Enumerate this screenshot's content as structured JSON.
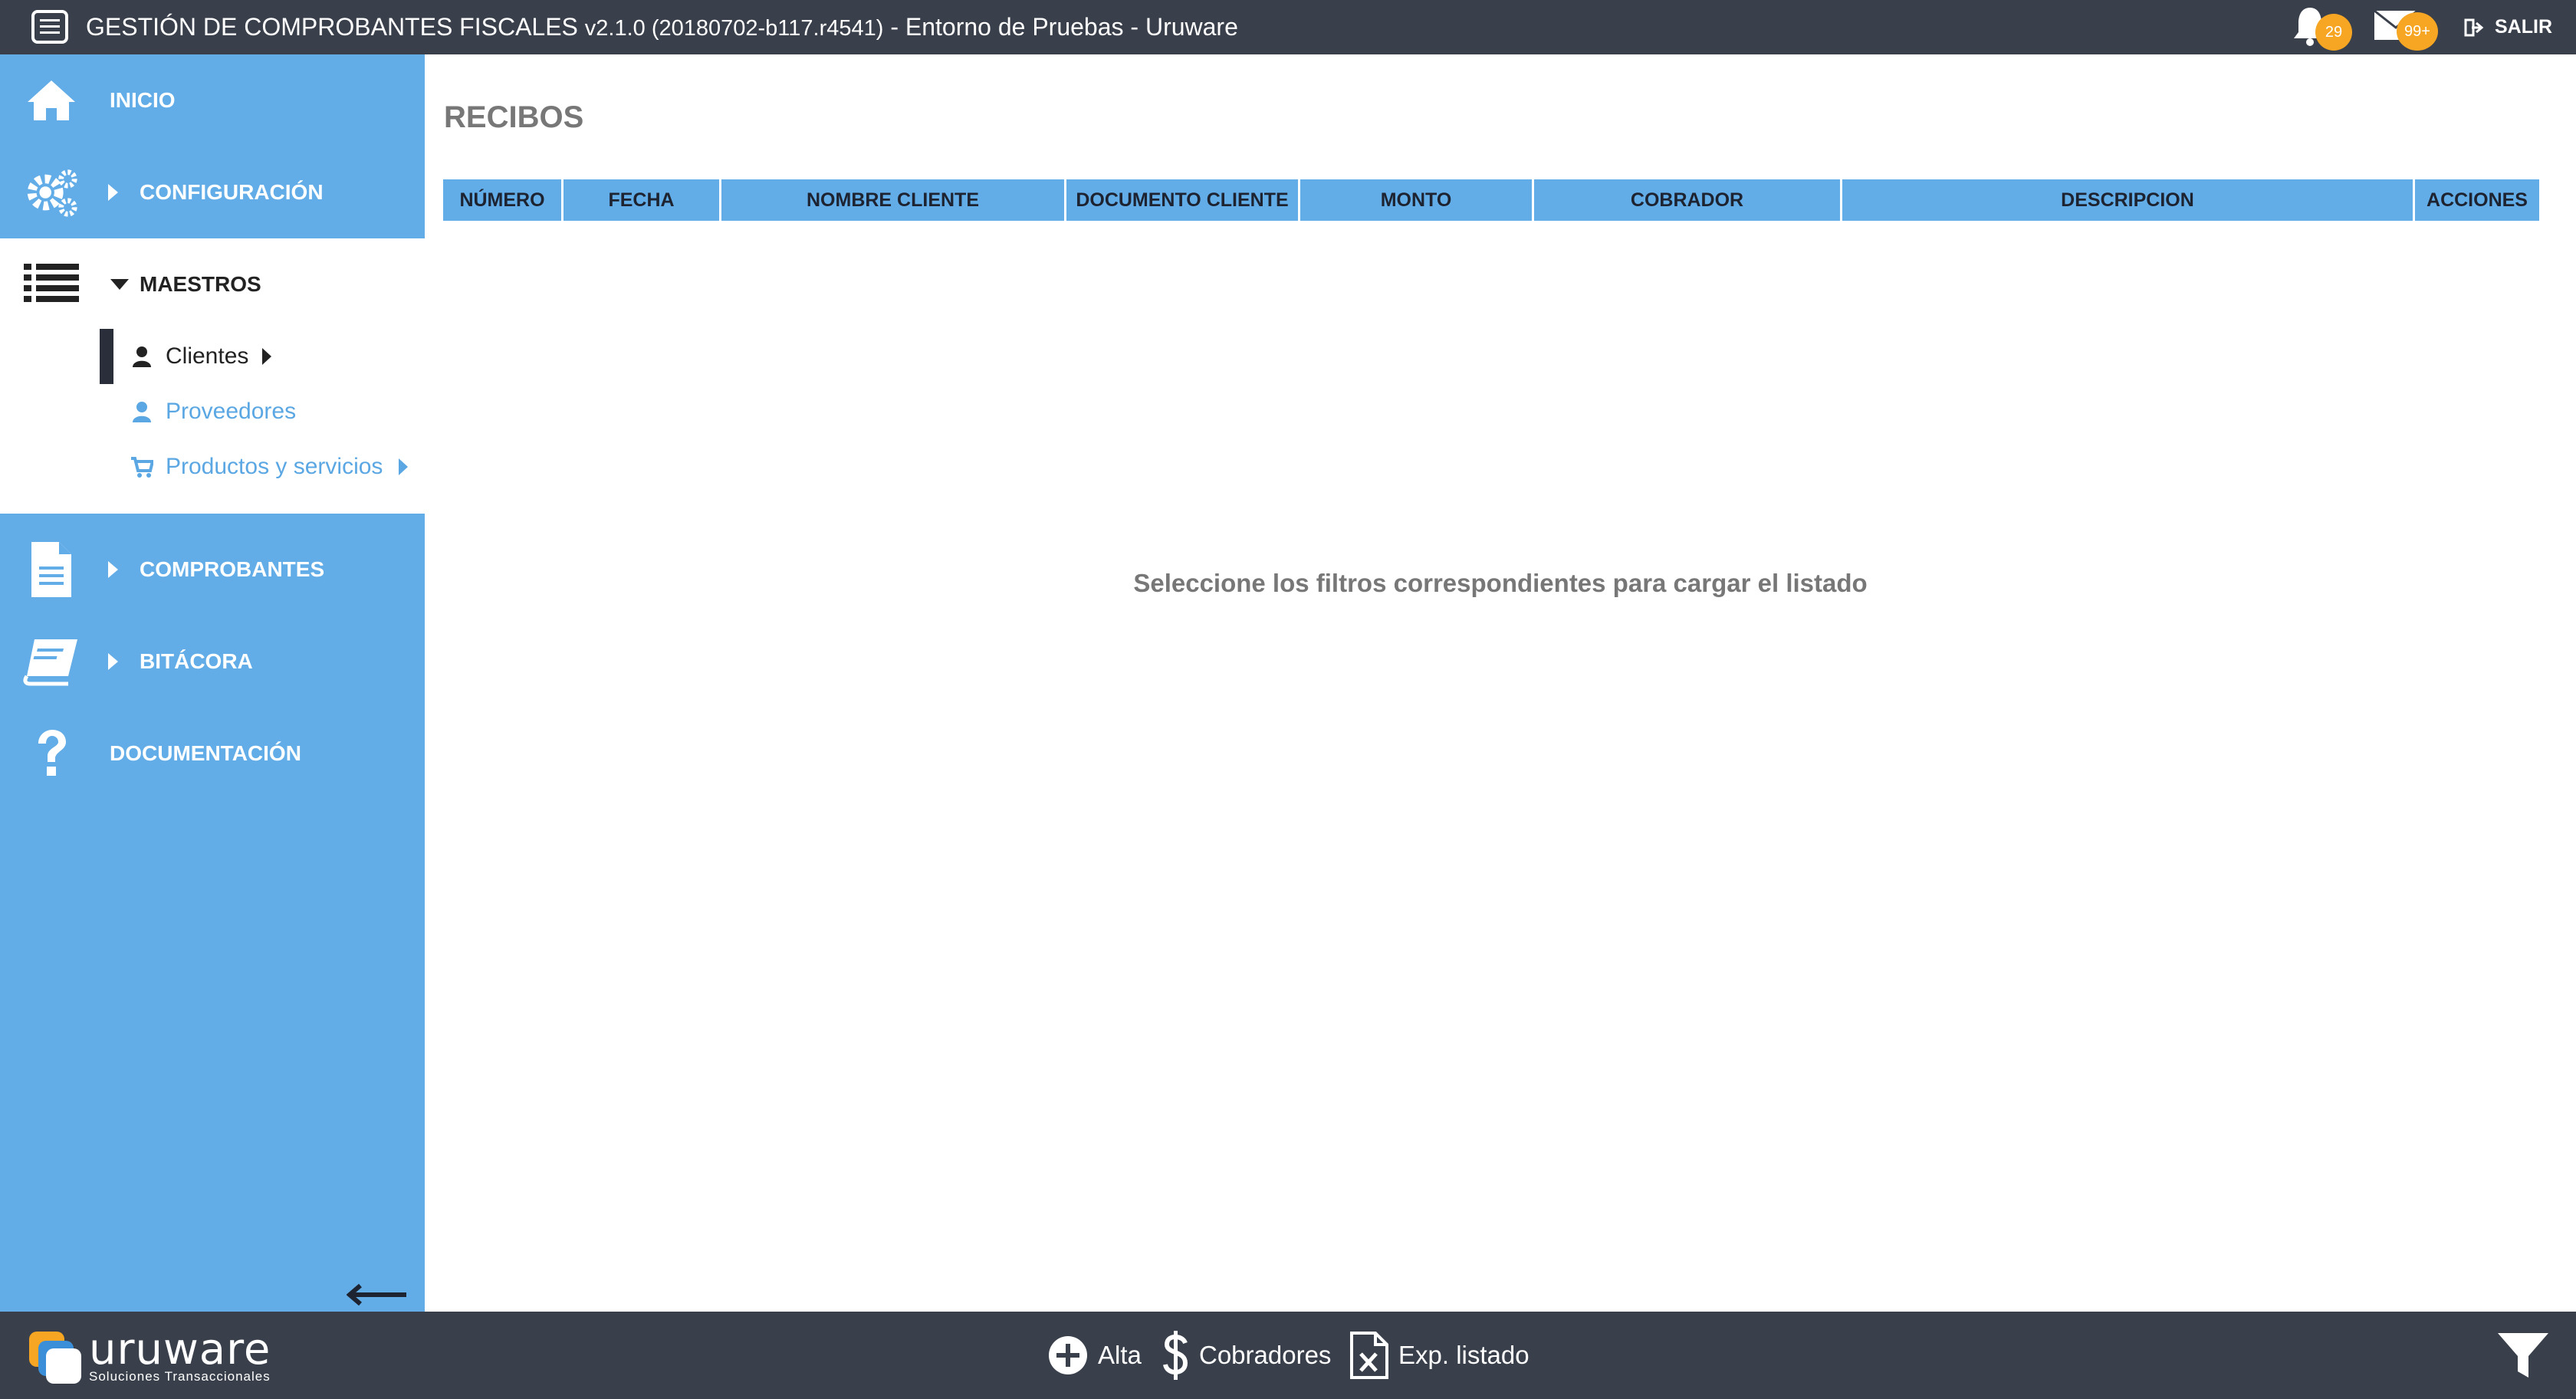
{
  "app": {
    "title": "GESTIÓN DE COMPROBANTES FISCALES",
    "version": "v2.1.0 (20180702-b117.r4541)",
    "environment": "- Entorno de Pruebas - Uruware",
    "notifications_count": "29",
    "messages_count": "99+",
    "logout_label": "SALIR"
  },
  "sidebar": {
    "items": [
      {
        "label": "INICIO",
        "icon": "home-icon"
      },
      {
        "label": "CONFIGURACIÓN",
        "icon": "gears-icon"
      },
      {
        "label": "MAESTROS",
        "icon": "list-icon"
      },
      {
        "label": "COMPROBANTES",
        "icon": "document-icon"
      },
      {
        "label": "BITÁCORA",
        "icon": "book-icon"
      },
      {
        "label": "DOCUMENTACIÓN",
        "icon": "question-icon"
      }
    ],
    "submenu": [
      {
        "label": "Clientes",
        "icon": "user-icon",
        "active": true
      },
      {
        "label": "Proveedores",
        "icon": "user-icon",
        "active": false
      },
      {
        "label": "Productos y servicios",
        "icon": "cart-icon",
        "active": false
      }
    ]
  },
  "main": {
    "title": "RECIBOS",
    "columns": [
      "NÚMERO",
      "FECHA",
      "NOMBRE CLIENTE",
      "DOCUMENTO CLIENTE",
      "MONTO",
      "COBRADOR",
      "DESCRIPCION",
      "ACCIONES"
    ],
    "empty_message": "Seleccione los filtros correspondientes para cargar el listado"
  },
  "footer": {
    "brand": "uruware",
    "tagline": "Soluciones Transaccionales",
    "actions": [
      {
        "label": "Alta",
        "icon": "plus-circle-icon"
      },
      {
        "label": "Cobradores",
        "icon": "dollar-icon"
      },
      {
        "label": "Exp. listado",
        "icon": "excel-icon"
      }
    ]
  },
  "colors": {
    "topbar": "#3a404b",
    "sidebar": "#62ade8",
    "badge": "#f6a623"
  }
}
